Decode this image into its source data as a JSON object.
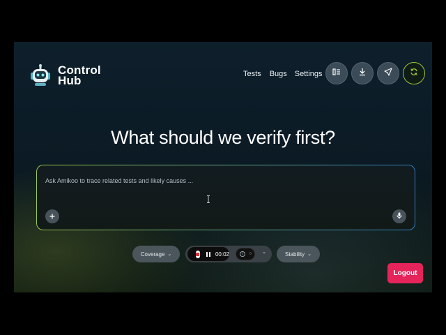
{
  "brand": {
    "line1": "Control",
    "line2": "Hub"
  },
  "nav": {
    "tests": "Tests",
    "bugs": "Bugs",
    "settings": "Settings"
  },
  "toolbar": {
    "icons": [
      "layout-icon",
      "download-icon",
      "send-icon",
      "refresh-icon"
    ],
    "accent_color": "#9bc53d"
  },
  "hero": {
    "headline": "What should we verify first?"
  },
  "prompt": {
    "placeholder": "Ask Amikoo to trace related tests and likely causes ...",
    "value": ""
  },
  "chips": {
    "coverage": "Coverage",
    "stability": "Stability"
  },
  "recorder": {
    "time": "00:02",
    "stop_color": "#e02a36"
  },
  "mini_control": {
    "value": "0"
  },
  "logout": {
    "label": "Logout",
    "color": "#e4245a"
  }
}
